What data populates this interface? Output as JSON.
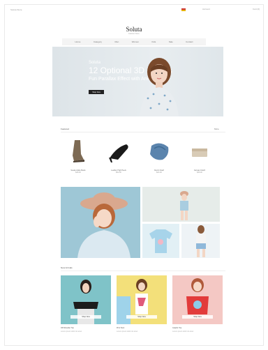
{
  "topbar": {
    "welcome": "Soluta Store",
    "account": "Account",
    "cart": "Cart (0)"
  },
  "header": {
    "logo": "Soluta",
    "tagline": "Fashion Store"
  },
  "nav": {
    "items": [
      "Home",
      "Category",
      "Men",
      "Women",
      "Kids",
      "Sale",
      "Contact"
    ]
  },
  "hero": {
    "brand": "Soluta",
    "headline": "12 Optional 3D Effects",
    "subheadline": "Fun Parallax Effect with Animation",
    "button": "Shop Now"
  },
  "featured": {
    "title": "Featured",
    "more": "More",
    "products": [
      {
        "name": "Suede Ankle Boots",
        "price": "$48.00"
      },
      {
        "name": "Leather High Heels",
        "price": "$52.00"
      },
      {
        "name": "Denim Scarf",
        "price": "$24.00"
      },
      {
        "name": "Canvas Clutch",
        "price": "$36.00"
      }
    ]
  },
  "arrivals": {
    "title": "New Arrivals",
    "items": [
      {
        "name": "Off-Shoulder Top",
        "tag": "Shop Now",
        "desc": "Lorem ipsum dolor sit amet"
      },
      {
        "name": "Print Tank",
        "tag": "Shop Now",
        "desc": "Lorem ipsum dolor sit amet"
      },
      {
        "name": "Graphic Tee",
        "tag": "Shop Now",
        "desc": "Lorem ipsum dolor sit amet"
      }
    ]
  }
}
